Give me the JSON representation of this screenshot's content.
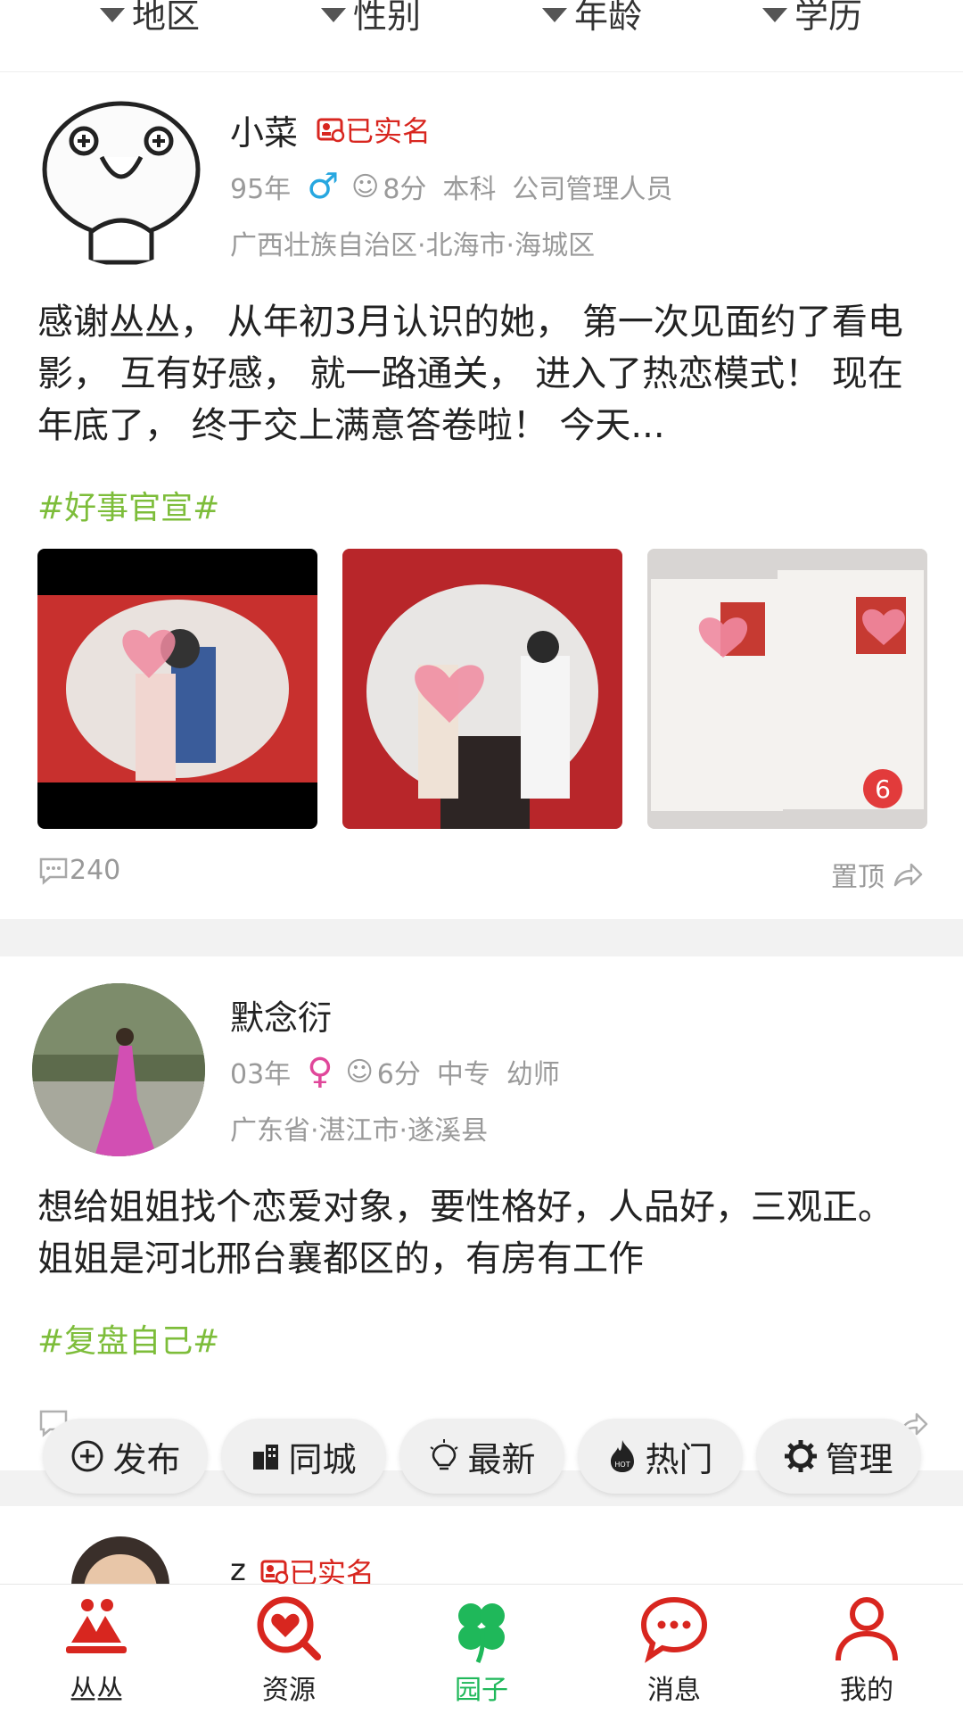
{
  "filters": [
    "地区",
    "性别",
    "年龄",
    "学历"
  ],
  "posts": [
    {
      "name": "小菜",
      "verified_label": "已实名",
      "birth_year": "95年",
      "gender_symbol": "♂",
      "score": "8分",
      "education": "本科",
      "occupation": "公司管理人员",
      "location": "广西壮族自治区·北海市·海城区",
      "content": "感谢丛丛， 从年初3月认识的她， 第一次见面约了看电影， 互有好感， 就一路通关， 进入了热恋模式！ 现在年底了， 终于交上满意答卷啦！ 今天...",
      "tag": "#好事官宣#",
      "photo_count_badge": "6",
      "comment_count": "240",
      "pin_label": "置顶"
    },
    {
      "name": "默念衍",
      "birth_year": "03年",
      "gender_symbol": "♀",
      "score": "6分",
      "education": "中专",
      "occupation": "幼师",
      "location": "广东省·湛江市·遂溪县",
      "content": "想给姐姐找个恋爱对象，要性格好，人品好，三观正。 姐姐是河北邢台襄都区的，有房有工作",
      "tag": "#复盘自己#"
    },
    {
      "name": "z",
      "verified_label": "已实名"
    }
  ],
  "actions": [
    "发布",
    "同城",
    "最新",
    "热门",
    "管理"
  ],
  "nav": [
    "丛丛",
    "资源",
    "园子",
    "消息",
    "我的"
  ],
  "colors": {
    "accent_red": "#d8261f",
    "tag_green": "#7dbd3a",
    "active_green": "#1fb85a",
    "male_blue": "#27a7e0",
    "female_pink": "#e0479a"
  }
}
